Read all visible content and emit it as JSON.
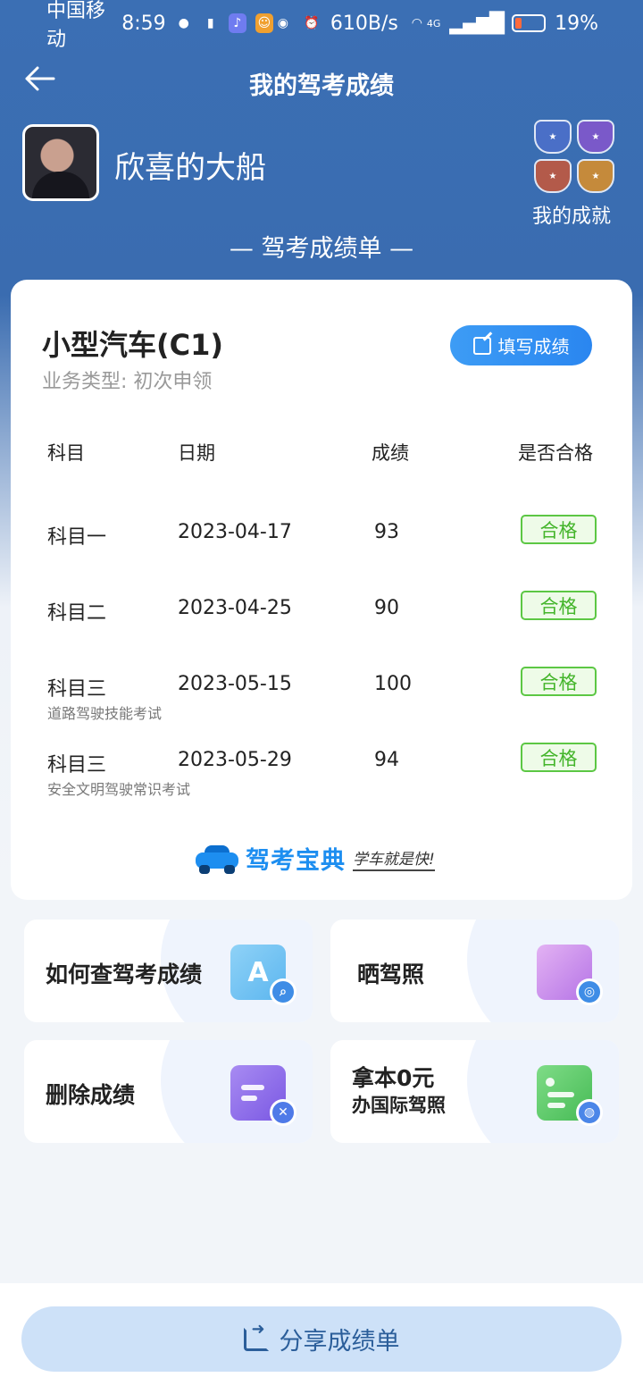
{
  "status_bar": {
    "carrier": "中国移动",
    "time": "8:59",
    "net_speed": "610B/s",
    "signal": "4G",
    "battery": "19%"
  },
  "nav": {
    "title": "我的驾考成绩",
    "back_icon": "arrow-left-icon"
  },
  "profile": {
    "username": "欣喜的大船",
    "achievements_label": "我的成就"
  },
  "sheet_title": "— 驾考成绩单 —",
  "card": {
    "license_type": "小型汽车(C1)",
    "business_type": "业务类型:  初次申领",
    "fill_button": "填写成绩",
    "headers": {
      "subject": "科目",
      "date": "日期",
      "score": "成绩",
      "pass": "是否合格"
    },
    "rows": [
      {
        "subject": "科目一",
        "note": "",
        "date": "2023-04-17",
        "score": "93",
        "pass": "合格"
      },
      {
        "subject": "科目二",
        "note": "",
        "date": "2023-04-25",
        "score": "90",
        "pass": "合格"
      },
      {
        "subject": "科目三",
        "note": "道路驾驶技能考试",
        "date": "2023-05-15",
        "score": "100",
        "pass": "合格"
      },
      {
        "subject": "科目三",
        "note": "安全文明驾驶常识考试",
        "date": "2023-05-29",
        "score": "94",
        "pass": "合格"
      }
    ],
    "brand_name": "驾考宝典",
    "brand_slogan": "学车就是快!"
  },
  "tiles": {
    "how_to_check": "如何查驾考成绩",
    "show_license": "晒驾照",
    "delete_scores": "删除成绩",
    "intl_license_line1": "拿本0元",
    "intl_license_line2": "办国际驾照"
  },
  "share_button": "分享成绩单",
  "colors": {
    "header_blue": "#3b6fb4",
    "accent": "#2a86f0",
    "pass_green": "#44b52b"
  }
}
